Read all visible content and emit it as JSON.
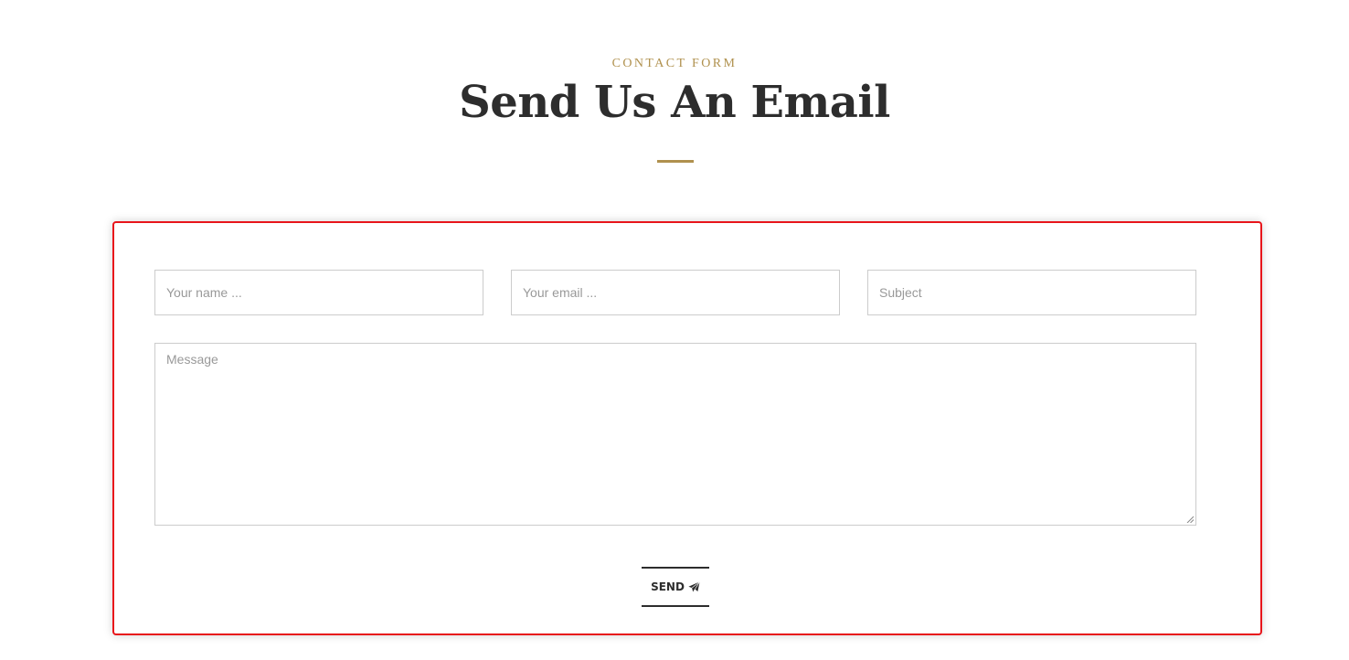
{
  "header": {
    "eyebrow": "CONTACT FORM",
    "title": "Send Us An Email"
  },
  "form": {
    "name_placeholder": "Your name ...",
    "email_placeholder": "Your email ...",
    "subject_placeholder": "Subject",
    "message_placeholder": "Message",
    "send_label": "SEND",
    "send_icon": "paper-plane-icon"
  },
  "colors": {
    "accent": "#b0914e",
    "text_dark": "#2d2d2d",
    "highlight_border": "#e8151b"
  }
}
